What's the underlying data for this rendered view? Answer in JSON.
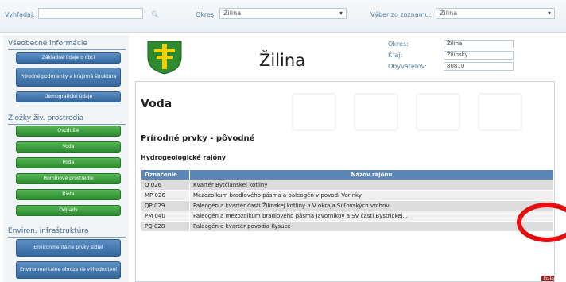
{
  "search": {
    "label": "Vyhľadaj:",
    "value": "",
    "okres_label": "Okres:",
    "okres_value": "Žilina",
    "vyber_label": "Výber zo zoznamu:",
    "vyber_value": "Žilina"
  },
  "sidebar": {
    "sections": [
      {
        "title": "Všeobecné informácie",
        "items": [
          "Základné údaje o obci",
          "Prírodné podmienky a krajinná štruktúra",
          "Demografické údaje"
        ]
      },
      {
        "title": "Zložky živ. prostredia",
        "items": [
          "Ovzdušie",
          "Voda",
          "Pôda",
          "Horninové prostredie",
          "Biota",
          "Odpady"
        ]
      },
      {
        "title": "Environ. infraštruktúra",
        "items": [
          "Environmentálne prvky sídiel",
          "Environmentálne ohrozenie výhodnotení"
        ]
      }
    ]
  },
  "header": {
    "town": "Žilina",
    "info": [
      {
        "label": "Okres:",
        "value": "Žilina"
      },
      {
        "label": "Kraj:",
        "value": "Žilinský"
      },
      {
        "label": "Obyvateľov:",
        "value": "80810"
      }
    ]
  },
  "content": {
    "title": "Voda",
    "subtitle": "Prírodné prvky - pôvodné",
    "section": "Hydrogeologické rajóny",
    "table": {
      "headers": [
        "Označenie",
        "Názov rajónu"
      ],
      "rows": [
        [
          "Q 026",
          "Kvartér Bytčianskej kotliny"
        ],
        [
          "MP 026",
          "Mezozoikum bradlového pásma a paleogén v povodí Varínky"
        ],
        [
          "QP 029",
          "Paleogén a kvartér časti Žilinskej kotliny a V okraja Súľovských vrchov"
        ],
        [
          "PM 040",
          "Paleogén a mezozoikum bradlového pásma Javorníkov a SV časti Bystrickej..."
        ],
        [
          "PQ 028",
          "Paleogén a kvartér povodia Kysuce"
        ]
      ]
    },
    "more_button": "Ďalej"
  },
  "colors": {
    "annotation_circle": "#e21010",
    "nav_blue": "#3f74ab",
    "nav_green": "#3a9a3b",
    "table_header": "#5b87b8"
  }
}
